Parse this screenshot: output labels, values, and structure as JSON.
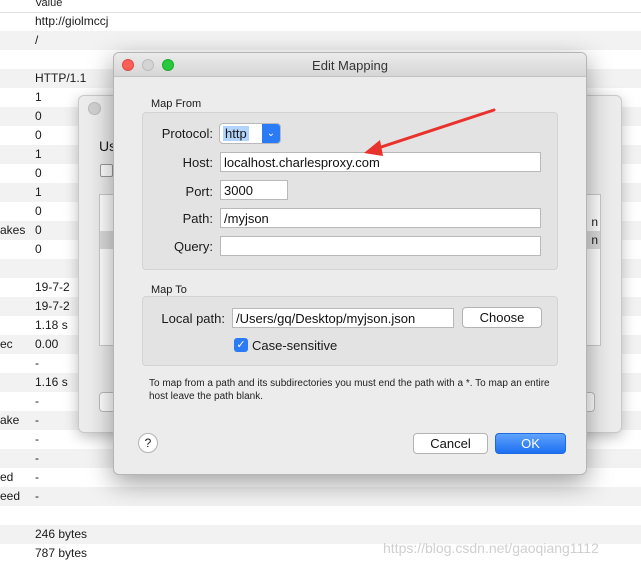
{
  "background": {
    "header": "Value",
    "rows": [
      {
        "name": "",
        "value": "http://giolmccj"
      },
      {
        "name": "",
        "value": "/"
      },
      {
        "name": "",
        "value": ""
      },
      {
        "name": "",
        "value": "HTTP/1.1"
      },
      {
        "name": "",
        "value": "1"
      },
      {
        "name": "",
        "value": "0"
      },
      {
        "name": "",
        "value": "0"
      },
      {
        "name": "",
        "value": "1"
      },
      {
        "name": "",
        "value": "0"
      },
      {
        "name": "",
        "value": "1"
      },
      {
        "name": "",
        "value": "0"
      },
      {
        "name": "akes",
        "value": "0"
      },
      {
        "name": "",
        "value": "0"
      },
      {
        "name": "",
        "value": ""
      },
      {
        "name": "",
        "value": "19-7-2"
      },
      {
        "name": "",
        "value": "19-7-2"
      },
      {
        "name": "",
        "value": "1.18 s"
      },
      {
        "name": "ec",
        "value": "0.00"
      },
      {
        "name": "",
        "value": "-"
      },
      {
        "name": "",
        "value": "1.16 s"
      },
      {
        "name": "",
        "value": "-"
      },
      {
        "name": "ake",
        "value": "-"
      },
      {
        "name": "",
        "value": "-"
      },
      {
        "name": "",
        "value": "-"
      },
      {
        "name": "ed",
        "value": "-"
      },
      {
        "name": "eed",
        "value": "-"
      },
      {
        "name": "",
        "value": ""
      },
      {
        "name": "",
        "value": "246 bytes"
      },
      {
        "name": "",
        "value": "787 bytes"
      }
    ]
  },
  "behind_dialog": {
    "partial_text": "Us",
    "row_suffix_1": "n",
    "row_suffix_2": "n"
  },
  "dialog": {
    "title": "Edit Mapping",
    "map_from": {
      "label": "Map From",
      "protocol_label": "Protocol:",
      "protocol_value": "http",
      "host_label": "Host:",
      "host_value": "localhost.charlesproxy.com",
      "port_label": "Port:",
      "port_value": "3000",
      "path_label": "Path:",
      "path_value": "/myjson",
      "query_label": "Query:",
      "query_value": ""
    },
    "map_to": {
      "label": "Map To",
      "local_path_label": "Local path:",
      "local_path_value": "/Users/gq/Desktop/myjson.json",
      "choose_label": "Choose",
      "case_sensitive_label": "Case-sensitive",
      "case_sensitive_checked": true
    },
    "hint": "To map from a path and its subdirectories you must end the path with a *. To map an entire host leave the path blank.",
    "help_label": "?",
    "cancel_label": "Cancel",
    "ok_label": "OK"
  },
  "annotation": {
    "arrow_color": "#e8322b"
  },
  "watermark": "https://blog.csdn.net/gaoqiang1112",
  "colors": {
    "accent": "#2a7bf5",
    "close": "#fd5f57",
    "maximize": "#28c93f"
  }
}
